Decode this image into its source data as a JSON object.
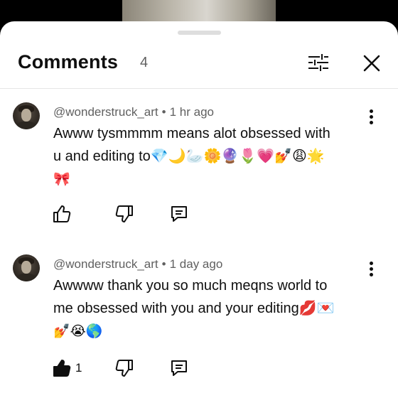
{
  "header": {
    "title": "Comments",
    "count": "4",
    "filter_icon": "sliders-icon",
    "close_icon": "close-icon"
  },
  "comments": [
    {
      "author": "@wonderstruck_art",
      "separator": "•",
      "time": "1 hr ago",
      "text_line1": "Awww tysmmmm means alot obsessed with",
      "text_line2": "u and editing to💎🌙🦢🌼🔮🌷💗💅😩🌟",
      "text_line3": "🎀",
      "likes": ""
    },
    {
      "author": "@wonderstruck_art",
      "separator": "•",
      "time": "1 day ago",
      "text_line1": "Awwww thank you so much meqns world to",
      "text_line2": "me obsessed with you and your editing💋💌",
      "text_line3": "💅😭🌎",
      "likes": "1"
    }
  ]
}
